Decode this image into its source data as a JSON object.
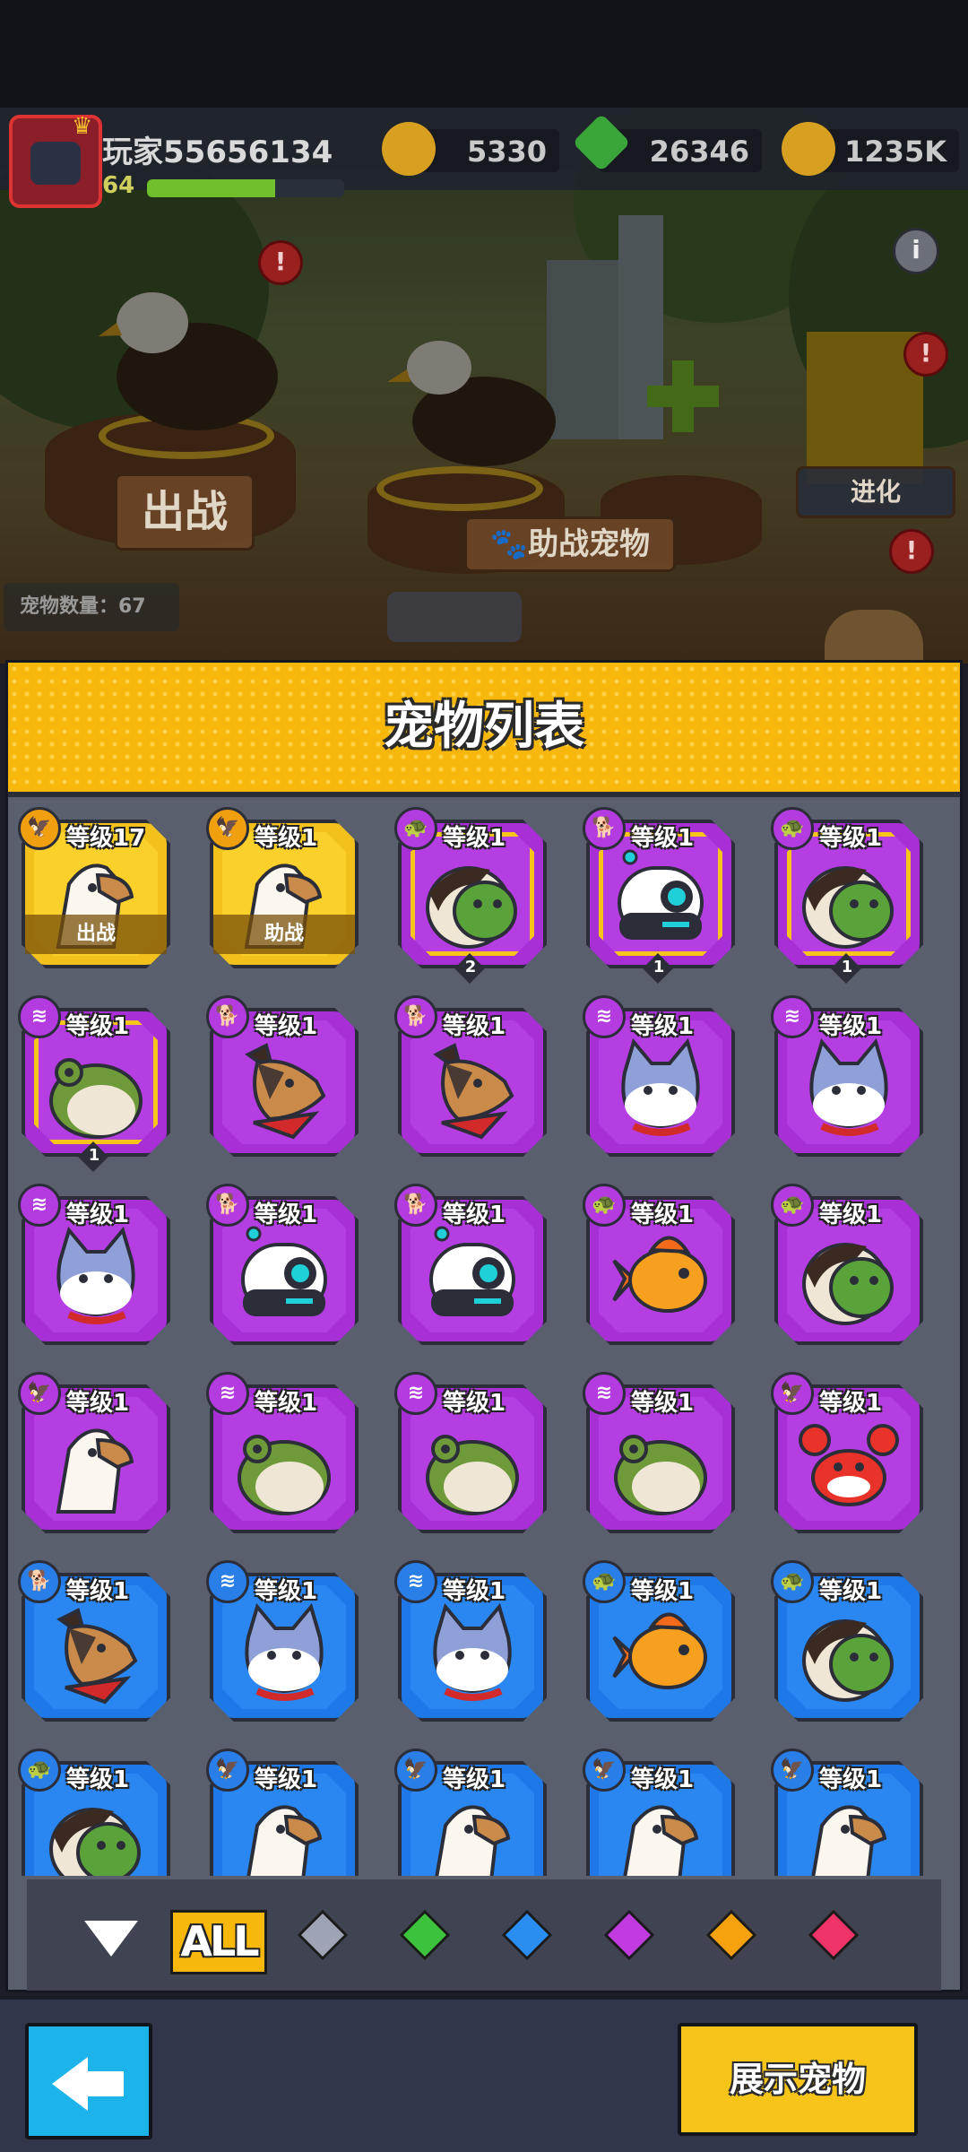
{
  "player": {
    "name": "玩家55656134",
    "level": "64",
    "xp_fraction": 0.65
  },
  "resources": [
    {
      "name": "coin",
      "value": "5330",
      "color": "#d8a020"
    },
    {
      "name": "gem",
      "value": "26346",
      "color": "#3aa63a"
    },
    {
      "name": "gold",
      "value": "1235K",
      "color": "#d8a020"
    }
  ],
  "scene": {
    "battle_label": "出战",
    "assist_label": "助战宠物",
    "evolve_label": "进化",
    "pet_count": "宠物数量：67",
    "alert": "!",
    "info": "i"
  },
  "panel": {
    "title": "宠物列表"
  },
  "pets": [
    {
      "rarity": "gold",
      "type": "eagle",
      "level": "等级17",
      "pet": "eagle",
      "tag": "出战"
    },
    {
      "rarity": "gold",
      "type": "eagle",
      "level": "等级1",
      "pet": "eagle",
      "tag": "助战"
    },
    {
      "rarity": "purple",
      "type": "turtle",
      "level": "等级1",
      "pet": "turtle",
      "count": "2",
      "selected": true
    },
    {
      "rarity": "purple",
      "type": "dog",
      "level": "等级1",
      "pet": "robot",
      "count": "1",
      "selected": true
    },
    {
      "rarity": "purple",
      "type": "turtle",
      "level": "等级1",
      "pet": "turtle",
      "count": "1",
      "selected": true
    },
    {
      "rarity": "purple",
      "type": "coin",
      "level": "等级1",
      "pet": "frog",
      "count": "1",
      "selected": true
    },
    {
      "rarity": "purple",
      "type": "dog",
      "level": "等级1",
      "pet": "dog"
    },
    {
      "rarity": "purple",
      "type": "dog",
      "level": "等级1",
      "pet": "dog"
    },
    {
      "rarity": "purple",
      "type": "coin",
      "level": "等级1",
      "pet": "cat"
    },
    {
      "rarity": "purple",
      "type": "coin",
      "level": "等级1",
      "pet": "cat"
    },
    {
      "rarity": "purple",
      "type": "coin",
      "level": "等级1",
      "pet": "cat"
    },
    {
      "rarity": "purple",
      "type": "dog",
      "level": "等级1",
      "pet": "robot"
    },
    {
      "rarity": "purple",
      "type": "dog",
      "level": "等级1",
      "pet": "robot"
    },
    {
      "rarity": "purple",
      "type": "turtle",
      "level": "等级1",
      "pet": "fish"
    },
    {
      "rarity": "purple",
      "type": "turtle",
      "level": "等级1",
      "pet": "turtle"
    },
    {
      "rarity": "purple",
      "type": "eagle",
      "level": "等级1",
      "pet": "eagle"
    },
    {
      "rarity": "purple",
      "type": "coin",
      "level": "等级1",
      "pet": "frog"
    },
    {
      "rarity": "purple",
      "type": "coin",
      "level": "等级1",
      "pet": "frog"
    },
    {
      "rarity": "purple",
      "type": "coin",
      "level": "等级1",
      "pet": "frog"
    },
    {
      "rarity": "purple",
      "type": "eagle",
      "level": "等级1",
      "pet": "crab"
    },
    {
      "rarity": "blue",
      "type": "dog",
      "level": "等级1",
      "pet": "dog"
    },
    {
      "rarity": "blue",
      "type": "coin",
      "level": "等级1",
      "pet": "cat"
    },
    {
      "rarity": "blue",
      "type": "coin",
      "level": "等级1",
      "pet": "cat"
    },
    {
      "rarity": "blue",
      "type": "turtle",
      "level": "等级1",
      "pet": "fish"
    },
    {
      "rarity": "blue",
      "type": "turtle",
      "level": "等级1",
      "pet": "turtle"
    },
    {
      "rarity": "blue",
      "type": "turtle",
      "level": "等级1",
      "pet": "turtle"
    },
    {
      "rarity": "blue",
      "type": "eagle",
      "level": "等级1",
      "pet": "eagle"
    },
    {
      "rarity": "blue",
      "type": "eagle",
      "level": "等级1",
      "pet": "eagle"
    },
    {
      "rarity": "blue",
      "type": "eagle",
      "level": "等级1",
      "pet": "eagle"
    },
    {
      "rarity": "blue",
      "type": "eagle",
      "level": "等级1",
      "pet": "eagle"
    }
  ],
  "filters": {
    "all_label": "ALL",
    "gems": [
      {
        "name": "gray",
        "color": "#9ea4b4"
      },
      {
        "name": "green",
        "color": "#3cc23c"
      },
      {
        "name": "blue",
        "color": "#2a8ef0"
      },
      {
        "name": "purple",
        "color": "#c03ce0"
      },
      {
        "name": "orange",
        "color": "#f6a10e"
      },
      {
        "name": "red",
        "color": "#f0346a"
      }
    ]
  },
  "bottom": {
    "show_label": "展示宠物"
  }
}
